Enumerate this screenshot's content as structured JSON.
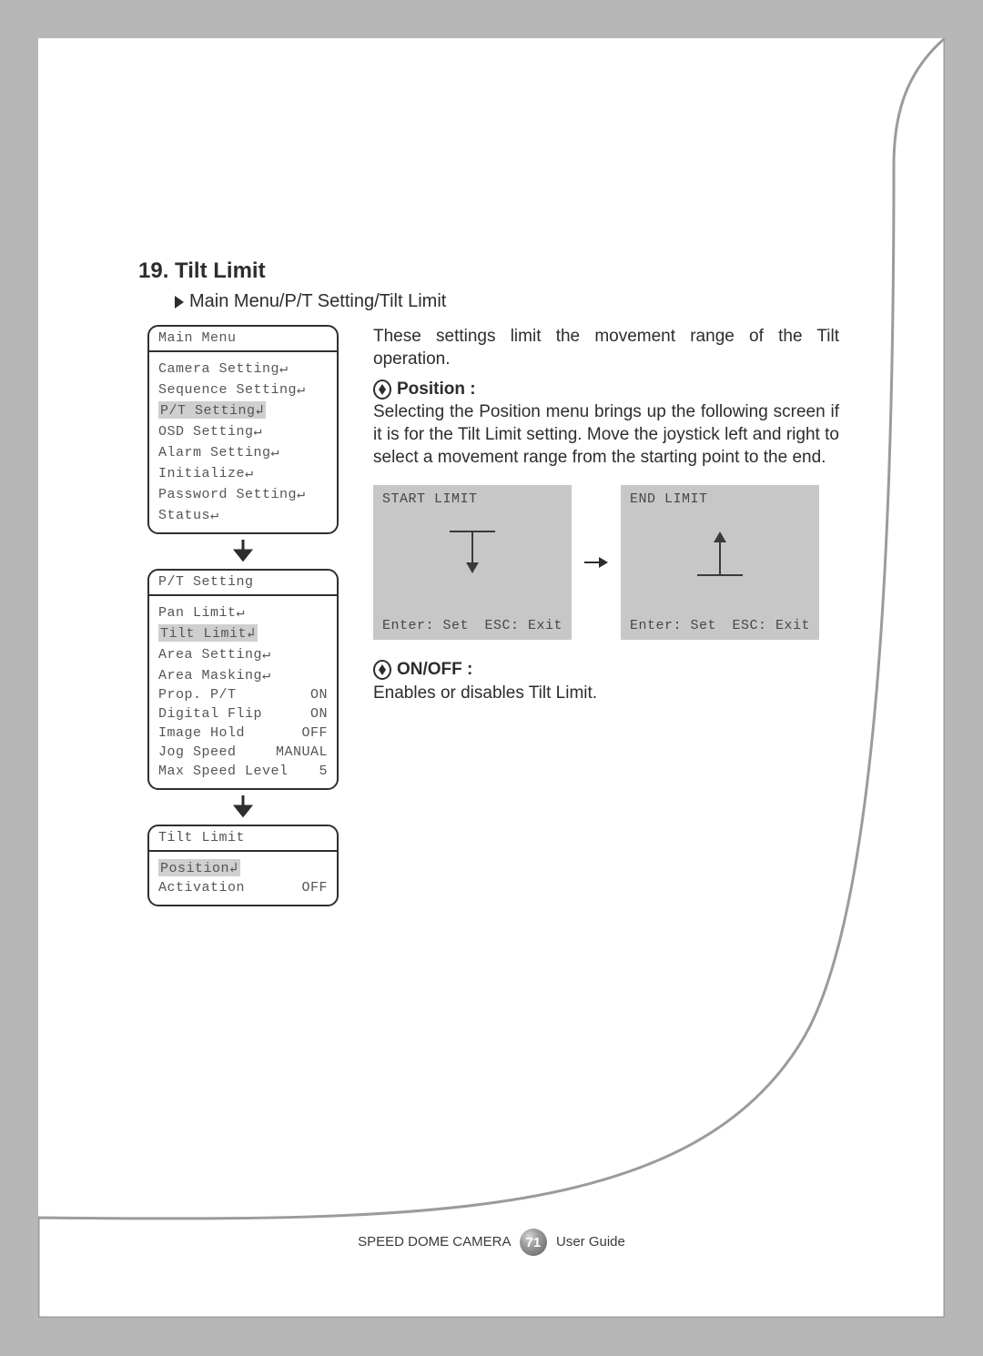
{
  "section": {
    "title": "19. Tilt Limit"
  },
  "breadcrumb": "Main Menu/P/T Setting/Tilt Limit",
  "intro": "These settings limit the movement range of the Tilt operation.",
  "position": {
    "label": "Position :",
    "text": "Selecting the Position menu brings up the following screen if it is for the Tilt Limit setting. Move the joystick left and right to select a movement range from the starting point to the end."
  },
  "onoff": {
    "label": "ON/OFF :",
    "text": "Enables or disables Tilt Limit."
  },
  "osd": {
    "main": {
      "title": "Main Menu",
      "items": [
        {
          "label": "Camera Setting",
          "marker": "↵"
        },
        {
          "label": "Sequence Setting",
          "marker": "↵"
        },
        {
          "label": "P/T Setting",
          "marker": "↲",
          "highlight": true
        },
        {
          "label": "OSD Setting",
          "marker": "↵"
        },
        {
          "label": "Alarm Setting",
          "marker": "↵"
        },
        {
          "label": "Initialize",
          "marker": "↵"
        },
        {
          "label": "Password Setting",
          "marker": "↵"
        },
        {
          "label": "Status",
          "marker": "↵"
        }
      ]
    },
    "pt": {
      "title": "P/T Setting",
      "items": [
        {
          "label": "Pan Limit",
          "marker": "↵",
          "value": ""
        },
        {
          "label": "Tilt Limit",
          "marker": "↲",
          "value": "",
          "highlight": true
        },
        {
          "label": "Area Setting",
          "marker": "↵",
          "value": ""
        },
        {
          "label": "Area Masking",
          "marker": "↵",
          "value": ""
        },
        {
          "label": "Prop. P/T",
          "marker": "",
          "value": "ON"
        },
        {
          "label": "Digital Flip",
          "marker": "",
          "value": "ON"
        },
        {
          "label": "Image Hold",
          "marker": "",
          "value": "OFF"
        },
        {
          "label": "Jog Speed",
          "marker": "",
          "value": "MANUAL"
        },
        {
          "label": "Max Speed Level",
          "marker": "",
          "value": "5"
        }
      ]
    },
    "tilt": {
      "title": "Tilt Limit",
      "items": [
        {
          "label": "Position",
          "marker": "↲",
          "value": "",
          "highlight": true
        },
        {
          "label": "Activation",
          "marker": "",
          "value": "OFF"
        }
      ]
    }
  },
  "limit_panels": {
    "start": {
      "title": "START LIMIT",
      "footer_left": "Enter: Set",
      "footer_right": "ESC: Exit"
    },
    "end": {
      "title": "END LIMIT",
      "footer_left": "Enter: Set",
      "footer_right": "ESC: Exit"
    }
  },
  "footer": {
    "left": "SPEED DOME CAMERA",
    "page": "71",
    "right": "User Guide"
  }
}
